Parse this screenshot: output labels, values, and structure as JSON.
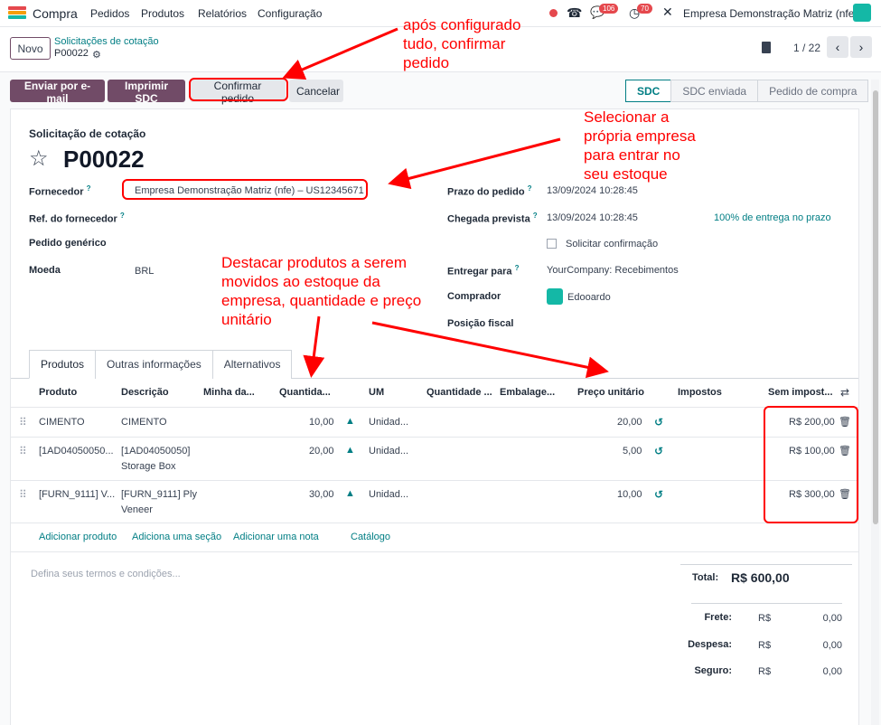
{
  "topnav": {
    "app_name": "Compra",
    "menu": [
      "Pedidos",
      "Produtos",
      "Relatórios",
      "Configuração"
    ],
    "chat_badge": "106",
    "activity_badge": "70",
    "company": "Empresa Demonstração Matriz (nfe)"
  },
  "breadcrumb": {
    "new_button": "Novo",
    "parent": "Solicitações de cotação",
    "current": "P00022",
    "pager": "1 / 22"
  },
  "actions": {
    "send_email": "Enviar por e-mail",
    "print": "Imprimir SDC",
    "confirm": "Confirmar pedido",
    "cancel": "Cancelar"
  },
  "status": [
    "SDC",
    "SDC enviada",
    "Pedido de compra"
  ],
  "status_active": "SDC",
  "form": {
    "doc_type": "Solicitação de cotação",
    "number": "P00022",
    "vendor_label": "Fornecedor",
    "vendor_value": "Empresa Demonstração Matriz (nfe) – US12345671",
    "vendor_ref_label": "Ref. do fornecedor",
    "blanket_label": "Pedido genérico",
    "currency_label": "Moeda",
    "currency_value": "BRL",
    "deadline_label": "Prazo do pedido",
    "deadline_value": "13/09/2024 10:28:45",
    "expected_label": "Chegada prevista",
    "expected_value": "13/09/2024 10:28:45",
    "on_time": "100% de entrega no prazo",
    "ask_confirm": "Solicitar confirmação",
    "deliver_to_label": "Entregar para",
    "deliver_to_value": "YourCompany: Recebimentos",
    "buyer_label": "Comprador",
    "buyer_value": "Edooardo",
    "fiscal_label": "Posição fiscal"
  },
  "tabs": [
    "Produtos",
    "Outras informações",
    "Alternativos"
  ],
  "table": {
    "headers": [
      "Produto",
      "Descrição",
      "Minha da...",
      "Quantida...",
      "UM",
      "Quantidade ...",
      "Embalage...",
      "Preço unitário",
      "Impostos",
      "Sem impost..."
    ],
    "rows": [
      {
        "product": "CIMENTO",
        "desc1": "CIMENTO",
        "desc2": "",
        "qty": "10,00",
        "uom": "Unidad...",
        "price": "20,00",
        "subtotal": "R$ 200,00"
      },
      {
        "product": "[1AD04050050...",
        "desc1": "[1AD04050050]",
        "desc2": "Storage Box",
        "qty": "20,00",
        "uom": "Unidad...",
        "price": "5,00",
        "subtotal": "R$ 100,00"
      },
      {
        "product": "[FURN_9111] V...",
        "desc1": "[FURN_9111] Ply",
        "desc2": "Veneer",
        "qty": "30,00",
        "uom": "Unidad...",
        "price": "10,00",
        "subtotal": "R$ 300,00"
      }
    ],
    "links": [
      "Adicionar produto",
      "Adiciona uma seção",
      "Adicionar uma nota",
      "Catálogo"
    ]
  },
  "terms_placeholder": "Defina seus termos e condições...",
  "totals": {
    "total_label": "Total:",
    "total_value": "R$ 600,00",
    "freight_label": "Frete:",
    "expense_label": "Despesa:",
    "insurance_label": "Seguro:",
    "currency": "R$",
    "freight": "0,00",
    "expense": "0,00",
    "insurance": "0,00"
  },
  "annotations": {
    "a1": [
      "após configurado",
      "tudo, confirmar",
      "pedido"
    ],
    "a2": [
      "Selecionar a",
      "própria empresa",
      "para entrar no",
      "seu estoque"
    ],
    "a3": [
      "Destacar produtos a serem",
      "movidos ao estoque da",
      "empresa, quantidade e preço",
      "unitário"
    ]
  },
  "colors": {
    "brand": "#714b67",
    "link": "#017e84",
    "annotation": "#ff0000"
  }
}
